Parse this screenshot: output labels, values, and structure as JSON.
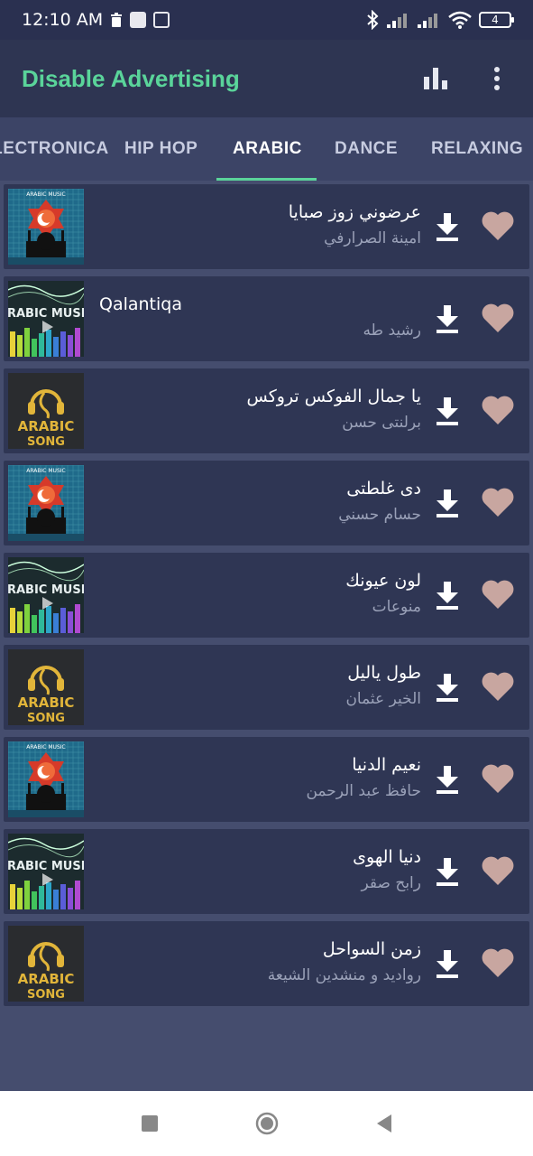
{
  "status_bar": {
    "time": "12:10 AM",
    "battery": "4"
  },
  "app_bar": {
    "title": "Disable Advertising"
  },
  "tabs": [
    {
      "label": "ELECTRONICA",
      "active": false
    },
    {
      "label": "HIP HOP",
      "active": false
    },
    {
      "label": "ARABIC",
      "active": true
    },
    {
      "label": "DANCE",
      "active": false
    },
    {
      "label": "RELAXING",
      "active": false
    }
  ],
  "thumbnails": {
    "arabic_music_mosque": {
      "caption": "ARABIC MUSIC"
    },
    "arabic_music_eq": {
      "caption": "ARABIC MUSIC"
    },
    "arabic_song": {
      "caption_top": "ARABIC",
      "caption_bottom": "SONG"
    }
  },
  "songs": [
    {
      "title": "عرضوني زوز صبايا",
      "artist": "امينة الصرارفي",
      "thumb": "mosque"
    },
    {
      "title": "Qalantiqa",
      "artist": "رشيد طه",
      "thumb": "eq"
    },
    {
      "title": "يا جمال الفوكس تروكس",
      "artist": "برلنتى حسن",
      "thumb": "song"
    },
    {
      "title": "دى غلطتى",
      "artist": "حسام حسني",
      "thumb": "mosque"
    },
    {
      "title": "لون عيونك",
      "artist": "منوعات",
      "thumb": "eq"
    },
    {
      "title": "طول ياليل",
      "artist": "الخير عثمان",
      "thumb": "song"
    },
    {
      "title": "نعيم الدنيا",
      "artist": "حافظ عبد الرحمن",
      "thumb": "mosque"
    },
    {
      "title": "دنيا الهوى",
      "artist": "رابح صقر",
      "thumb": "eq"
    },
    {
      "title": "زمن السواحل",
      "artist": "رواديد و منشدين الشيعة",
      "thumb": "song"
    }
  ],
  "colors": {
    "accent": "#5ad49a",
    "background": "#454d6e",
    "row": "#2f3654",
    "heart": "#c8a6a0"
  }
}
